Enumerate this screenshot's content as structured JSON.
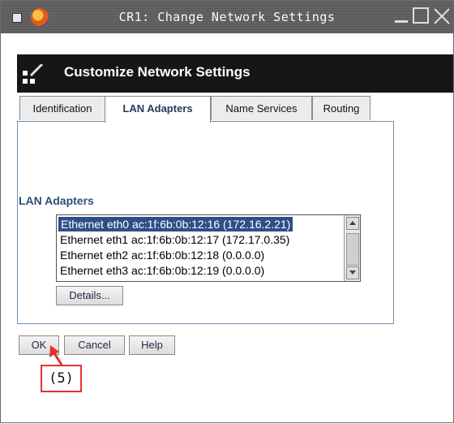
{
  "window": {
    "title": "CR1: Change Network Settings"
  },
  "dialog": {
    "header_title": "Customize Network Settings",
    "tabs": [
      {
        "label": "Identification"
      },
      {
        "label": "LAN Adapters"
      },
      {
        "label": "Name Services"
      },
      {
        "label": "Routing"
      }
    ],
    "active_tab": "LAN Adapters",
    "section_label": "LAN Adapters",
    "adapters": [
      {
        "label": "Ethernet eth0 ac:1f:6b:0b:12:16 (172.16.2.21)",
        "selected": true
      },
      {
        "label": "Ethernet eth1 ac:1f:6b:0b:12:17 (172.17.0.35)",
        "selected": false
      },
      {
        "label": "Ethernet eth2 ac:1f:6b:0b:12:18 (0.0.0.0)",
        "selected": false
      },
      {
        "label": "Ethernet eth3 ac:1f:6b:0b:12:19 (0.0.0.0)",
        "selected": false
      }
    ],
    "details_button": "Details...",
    "ok_button": "OK",
    "cancel_button": "Cancel",
    "help_button": "Help"
  },
  "annotation": {
    "label": "(5)",
    "color": "#e53030"
  },
  "colors": {
    "selection": "#2f4e88",
    "section_label": "#2f4e7a",
    "header_bg": "#161616"
  }
}
